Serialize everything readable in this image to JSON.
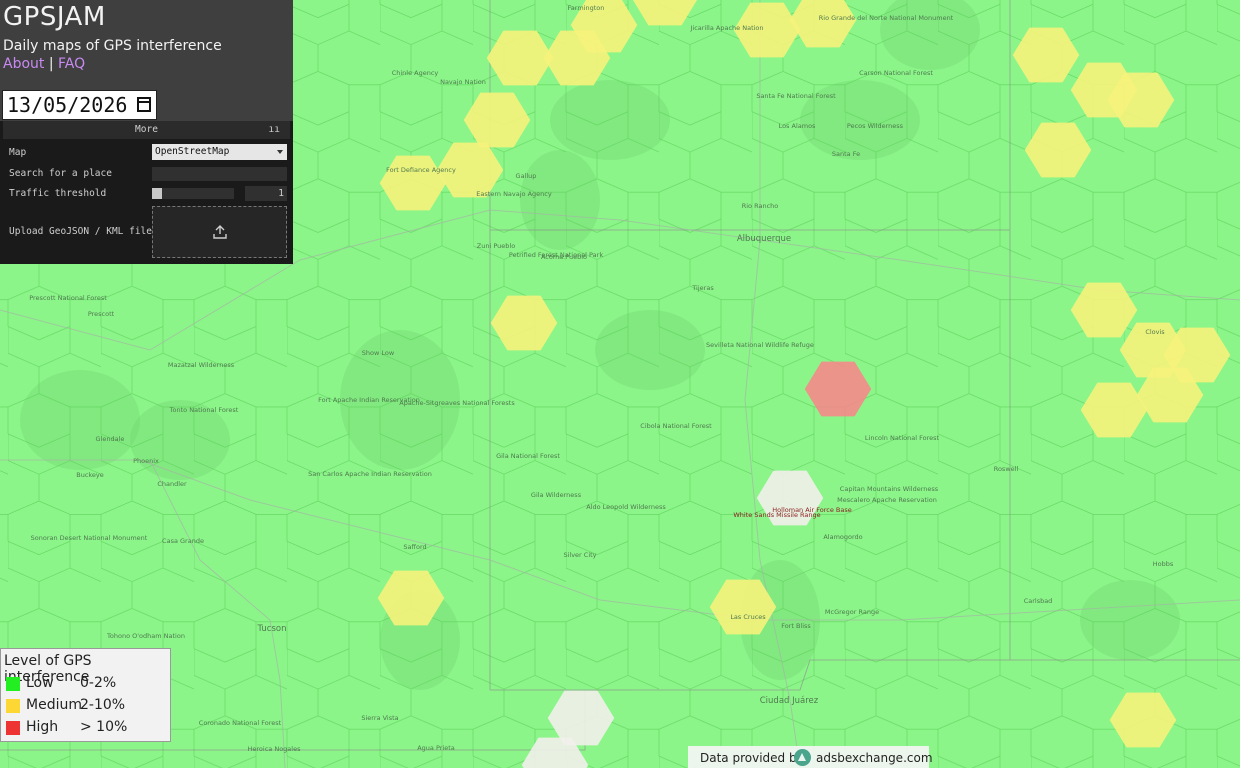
{
  "header": {
    "title": "GPSJAM",
    "subtitle": "Daily maps of GPS interference",
    "about_link": "About",
    "separator": "|",
    "faq_link": "FAQ",
    "date_value": "13/05/2026"
  },
  "controls": {
    "panel_title": "More",
    "collapse_icon": "pause-icon",
    "map_label": "Map",
    "map_selected": "OpenStreetMap",
    "search_label": "Search for a place",
    "search_value": "",
    "threshold_label": "Traffic threshold",
    "threshold_value": "1",
    "upload_label": "Upload GeoJSON / KML file",
    "upload_icon": "upload-icon"
  },
  "legend": {
    "title": "Level of GPS interference",
    "items": [
      {
        "name": "Low",
        "range": "0-2%",
        "color": "#22ee22"
      },
      {
        "name": "Medium",
        "range": "2-10%",
        "color": "#fdd835"
      },
      {
        "name": "High",
        "range": "> 10%",
        "color": "#ee3333"
      }
    ]
  },
  "attribution": {
    "prefix": "Data provided by",
    "logo_icon": "adsbexchange-logo-icon",
    "site": "adsbexchange.com"
  },
  "map": {
    "colors": {
      "low_fill": "#8cf58a",
      "medium_fill": "#f7f37c",
      "high_fill": "#f58a8a",
      "nodata_fill": "#f2f0ec"
    },
    "place_labels": [
      "Farmington",
      "Jicarilla Apache Nation",
      "Rio Grande del Norte National Monument",
      "Navajo Nation",
      "Chinle Agency",
      "Santa Fe National Forest",
      "Carson National Forest",
      "Los Alamos",
      "Santa Fe",
      "Pecos Wilderness",
      "Fort Defiance Agency",
      "Gallup",
      "Eastern Navajo Agency",
      "Rio Rancho",
      "Albuquerque",
      "Tijeras",
      "Cibola National Forest",
      "Petrified Forest National Park",
      "Zuni Pueblo",
      "Acoma Pueblo",
      "Prescott National Forest",
      "Prescott",
      "Show Low",
      "Sevilleta National Wildlife Refuge",
      "Mazatzal Wilderness",
      "Tonto National Forest",
      "Fort Apache Indian Reservation",
      "Apache-Sitgreaves National Forests",
      "Gila National Forest",
      "Lincoln National Forest",
      "Glendale",
      "Phoenix",
      "Buckeye",
      "Chandler",
      "San Carlos Apache Indian Reservation",
      "Gila Wilderness",
      "Aldo Leopold Wilderness",
      "White Sands Missile Range",
      "Holloman Air Force Base",
      "Capitan Mountains Wilderness",
      "Mescalero Apache Reservation",
      "Roswell",
      "Alamogordo",
      "Sonoran Desert National Monument",
      "Casa Grande",
      "Safford",
      "Silver City",
      "Las Cruces",
      "Fort Bliss",
      "McGregor Range",
      "Carlsbad",
      "Hobbs",
      "Tucson",
      "Tohono O'odham Nation",
      "Coronado National Forest",
      "Sierra Vista",
      "Heroica Nogales",
      "Agua Prieta",
      "Ciudad Juárez",
      "Clovis"
    ]
  }
}
